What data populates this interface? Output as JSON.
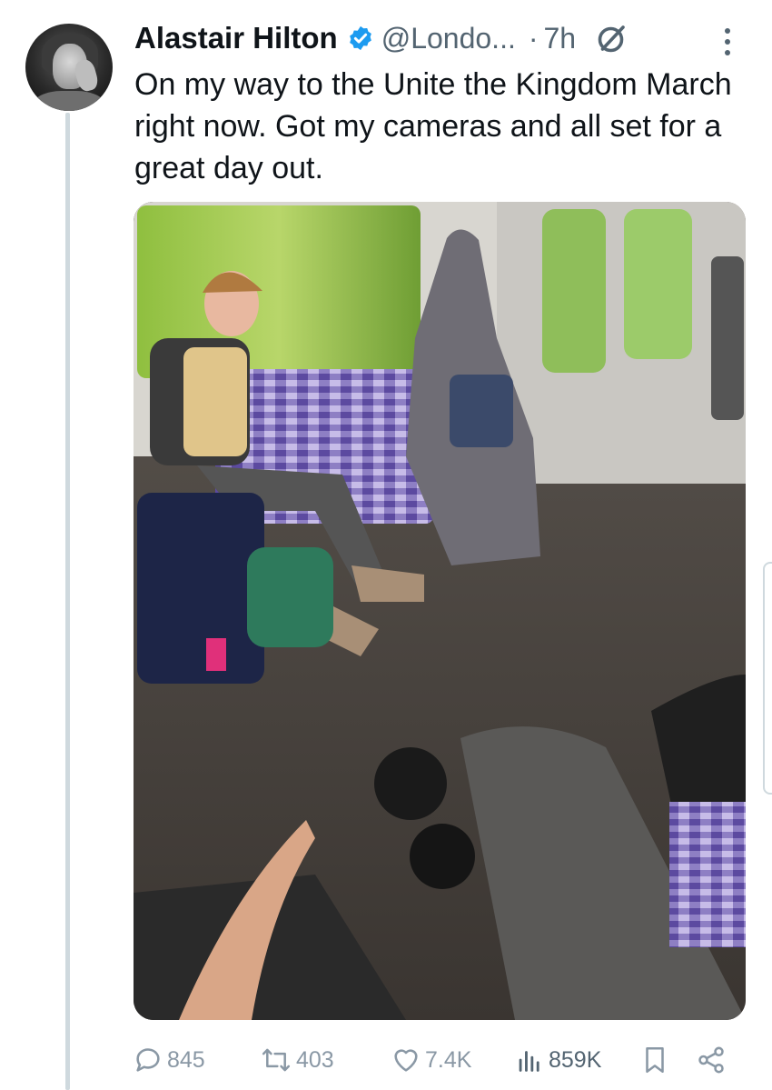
{
  "tweet": {
    "author_name": "Alastair Hilton",
    "handle": "@Londo...",
    "separator": "·",
    "time": "7h",
    "text": "On my way to the Unite the Kingdom March right now. Got my cameras and all set for a great day out.",
    "verified_color": "#1d9bf0"
  },
  "actions": {
    "replies": "845",
    "reposts": "403",
    "likes": "7.4K",
    "views": "859K"
  },
  "icons": [
    "verified-badge-icon",
    "grok-icon",
    "more-icon",
    "reply-icon",
    "repost-icon",
    "like-icon",
    "views-icon",
    "bookmark-icon",
    "share-icon"
  ]
}
